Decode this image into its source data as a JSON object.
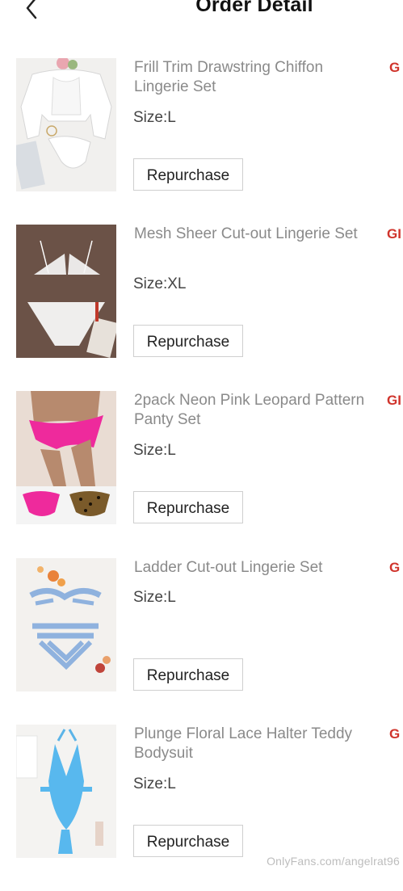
{
  "header": {
    "title": "Order Detail",
    "back_icon": "chevron-left-icon"
  },
  "items": [
    {
      "name": "Frill Trim Drawstring Chiffon Lingerie Set",
      "size": "Size:L",
      "repurchase_label": "Repurchase",
      "tag": "G"
    },
    {
      "name": "Mesh Sheer Cut-out Lingerie Set",
      "size": "Size:XL",
      "repurchase_label": "Repurchase",
      "tag": "GI"
    },
    {
      "name": "2pack Neon Pink Leopard Pattern Panty Set",
      "size": "Size:L",
      "repurchase_label": "Repurchase",
      "tag": "GI"
    },
    {
      "name": "Ladder Cut-out Lingerie Set",
      "size": "Size:L",
      "repurchase_label": "Repurchase",
      "tag": "G"
    },
    {
      "name": "Plunge Floral Lace Halter Teddy Bodysuit",
      "size": "Size:L",
      "repurchase_label": "Repurchase",
      "tag": "G"
    }
  ],
  "watermark": "OnlyFans.com/angelrat96",
  "colors": {
    "tag_red": "#d0342c",
    "name_gray": "#8a8a8a"
  }
}
